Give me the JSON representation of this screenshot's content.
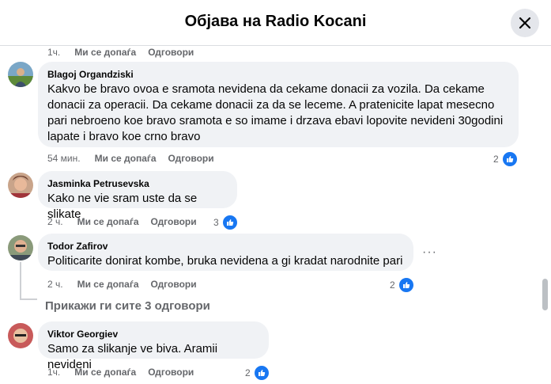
{
  "header": {
    "title": "Објава на Radio Kocani"
  },
  "top_meta": {
    "time": "1ч.",
    "like": "Ми се допаѓа",
    "reply": "Одговори"
  },
  "comments": [
    {
      "author": "Blagoj Organdziski",
      "lines": [
        "Kakvo be bravo ovoa e sramota nevidena da cekame donacii za vozila. Da cekame",
        "donacii za operacii. Da cekame donacii za da se leceme. A pratenicite lapat mesecno",
        "pari nebroeno koe bravo sramota e so imame i drzava ebavi lopovite nevideni 30godini",
        "lapate i bravo koe crno bravo"
      ],
      "time": "54 мин.",
      "like": "Ми се допаѓа",
      "reply": "Одговори",
      "reactions": "2"
    },
    {
      "author": "Jasminka Petrusevska",
      "lines": [
        "Kako ne vie sram uste da se slikate"
      ],
      "time": "2 ч.",
      "like": "Ми се допаѓа",
      "reply": "Одговори",
      "reactions": "3"
    },
    {
      "author": "Todor Zafirov",
      "lines": [
        "Politicarite donirat kombe, bruka nevidena a gi kradat narodnite pari"
      ],
      "time": "2 ч.",
      "like": "Ми се допаѓа",
      "reply": "Одговори",
      "reactions": "2",
      "more": "···"
    },
    {
      "author": "Viktor Georgiev",
      "lines": [
        "Samo za slikanje ve biva. Aramii nevideni"
      ],
      "time": "1ч.",
      "like": "Ми се допаѓа",
      "reply": "Одговори",
      "reactions": "2"
    }
  ],
  "show_replies": "Прикажи ги сите 3 одговори",
  "icons": {
    "close": "close-icon",
    "like": "like-icon",
    "more": "more-icon"
  },
  "colors": {
    "accent": "#1877f2",
    "bubble": "#f0f2f5",
    "meta": "#65676b"
  }
}
